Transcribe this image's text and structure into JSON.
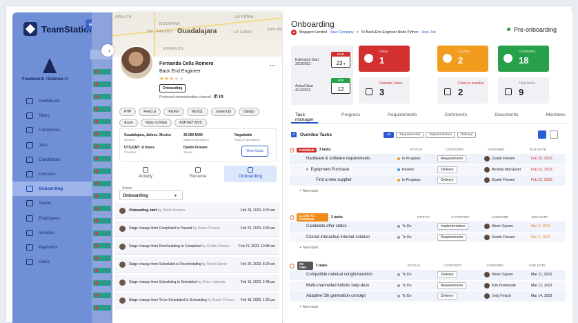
{
  "app": {
    "name": "TeamStation",
    "framework": "Framework <Science />"
  },
  "nav": [
    {
      "label": "Dashboard",
      "icon": "dashboard-icon"
    },
    {
      "label": "Tasks",
      "icon": "tasks-icon"
    },
    {
      "label": "Companies",
      "icon": "companies-icon"
    },
    {
      "label": "Jobs",
      "icon": "jobs-icon"
    },
    {
      "label": "Candidates",
      "icon": "candidates-icon"
    },
    {
      "label": "Contacts",
      "icon": "contacts-icon"
    },
    {
      "label": "Onboarding",
      "icon": "star-icon",
      "active": true
    },
    {
      "label": "Teams",
      "icon": "teams-icon"
    },
    {
      "label": "Employees",
      "icon": "employees-icon"
    },
    {
      "label": "Invoices",
      "icon": "invoices-icon"
    },
    {
      "label": "Payments",
      "icon": "payments-icon"
    },
    {
      "label": "Users",
      "icon": "users-icon"
    }
  ],
  "map": {
    "labels": [
      "APALITA",
      "MODERNA",
      "DEL FRESNO",
      "LA PEÑAL",
      "LA GAMA",
      "SAN AN",
      "MORELOS"
    ],
    "city": "Guadalajara"
  },
  "profile": {
    "name": "Fernanda Celis Romero",
    "role": "Back End Engineer",
    "rating": 3,
    "badge": "Onboarding",
    "pref_label": "Preferred communication channel",
    "pref_icons": "✆ in",
    "skills": [
      "PHP",
      "React.js",
      "Python",
      "MySQL",
      "Javascript",
      "Django",
      "Azure",
      "Ruby on Rails",
      "ASP.NET MVC"
    ],
    "location": "Guadalajara, Jalisco, Mexico",
    "location_label": "Location",
    "timezone": "UTC/GMT -6 hours",
    "timezone_label": "Timezone",
    "salary": "30,000 MXN",
    "salary_label": "Salary Expectations",
    "negotiable": "Negotiable",
    "negotiable_label": "Salary Expectations",
    "source": "Dustin Friesen",
    "source_label": "Source",
    "view_costs": "View Costs",
    "tabs": [
      "Activity",
      "Resume",
      "Onboarding"
    ],
    "status_label": "Status",
    "status_value": "Onboarding",
    "events": [
      {
        "text": "Onboarding start",
        "by": "by Dustin Friesen",
        "date": "Feb 28, 2023. 9:30 am",
        "bold": true
      },
      {
        "text": "Stage change from Completed to Passed",
        "by": "by Dustin Friesen",
        "date": "Feb 23, 2023. 9:30 am"
      },
      {
        "text": "Stage change from Rescheduling to Completed",
        "by": "by Dustin Friesen",
        "date": "Feb 21, 2023. 10:48 am"
      },
      {
        "text": "Stage change from Scheduled to Rescheduling",
        "by": "by Sherri Sporer",
        "date": "Feb 20, 2023. 8:23 am"
      },
      {
        "text": "Stage change from Scheduling to Scheduled",
        "by": "by Erica Lubowitz",
        "date": "Feb 19, 2023. 2:48 pm"
      },
      {
        "text": "Stage change from To be Scheduled to Scheduling",
        "by": "by Dustin Friesen",
        "date": "Feb 18, 2023. 1:32 pm"
      }
    ]
  },
  "main": {
    "title": "Onboarding",
    "company": "Megaport Limited",
    "view_company": "View Company",
    "sep": ">",
    "job": "Sr Back-End Engineer Node Python",
    "view_job": "View Job",
    "status": "Pre-onboarding",
    "est_label": "Estimated Start",
    "est_date": "3/23/2023",
    "est_month": "MAR",
    "est_day": "23",
    "act_label": "Actual Start",
    "act_date": "4/12/2023",
    "act_month": "APR",
    "act_day": "12",
    "stats": [
      {
        "label": "Delay",
        "value": "1"
      },
      {
        "label": "Caution",
        "value": "2"
      },
      {
        "label": "Comments",
        "value": "18"
      },
      {
        "label": "Overdue Tasks",
        "value": "3"
      },
      {
        "label": "Close to overdue",
        "value": "2"
      },
      {
        "label": "Total tasks",
        "value": "9"
      }
    ],
    "tabs": [
      "Task manager",
      "Progress",
      "Requirements",
      "Comments",
      "Documents",
      "Members"
    ],
    "overdue_tasks": "Overdue Tasks",
    "filters": [
      "All",
      "Requirements",
      "Implementation",
      "Delivery"
    ],
    "cols": [
      "STATUS",
      "CATEGORY",
      "ASSIGNEE",
      "DUE DATE"
    ],
    "new_task": "+ New task",
    "groups": [
      {
        "tag": "OVERDUE",
        "count": "3 tasks",
        "color": "#d33030",
        "rows": [
          {
            "name": "Hardware & software requirements",
            "status": "In Progress",
            "scolor": "#f29c1d",
            "cat": "Requirements",
            "assignee": "Dustin Friesen",
            "due": "Feb 20, 2023",
            "dclass": "overdue"
          },
          {
            "name": "Equipment Purchase",
            "status": "Review",
            "scolor": "#2d9adb",
            "cat": "Delivery",
            "assignee": "Beverly MacGyver",
            "due": "Feb 23, 2023",
            "dclass": "overdue",
            "caret": "▾"
          },
          {
            "name": "Find a new supplier",
            "status": "In Progress",
            "scolor": "#f29c1d",
            "cat": "Delivery",
            "assignee": "Dustin Friesen",
            "due": "Feb 22, 2023",
            "dclass": "overdue",
            "nest": true
          }
        ]
      },
      {
        "tag": "CLOSE TO OVERDUE",
        "count": "2 tasks",
        "color": "#f08a18",
        "rows": [
          {
            "name": "Candidate offer status",
            "status": "To Do",
            "scolor": "#999",
            "cat": "Implementation",
            "assignee": "Sherri Sporer",
            "due": "Mar 2, 2023",
            "dclass": "soon"
          },
          {
            "name": "Cloned interactive internet solution",
            "status": "To Do",
            "scolor": "#999",
            "cat": "Requirements",
            "assignee": "Dustin Friesen",
            "due": "Mar 2, 2023",
            "dclass": "soon"
          }
        ]
      },
      {
        "tag": "ON TIME",
        "count": "3 tasks",
        "color": "#555",
        "rows": [
          {
            "name": "Compatible national conglomeration",
            "status": "To Do",
            "scolor": "#999",
            "cat": "Delivery",
            "assignee": "Sherri Sporer",
            "due": "Mar 11, 2023",
            "dclass": ""
          },
          {
            "name": "Multi-channelled holistic help-desk",
            "status": "To Do",
            "scolor": "#999",
            "cat": "Requirements",
            "assignee": "Kim Powlowski",
            "due": "Mar 12, 2023",
            "dclass": ""
          },
          {
            "name": "Adaptive 5th generation concept",
            "status": "To Do",
            "scolor": "#999",
            "cat": "Delivery",
            "assignee": "Jody Fritsch",
            "due": "Mar 14, 2023",
            "dclass": ""
          }
        ]
      }
    ]
  }
}
